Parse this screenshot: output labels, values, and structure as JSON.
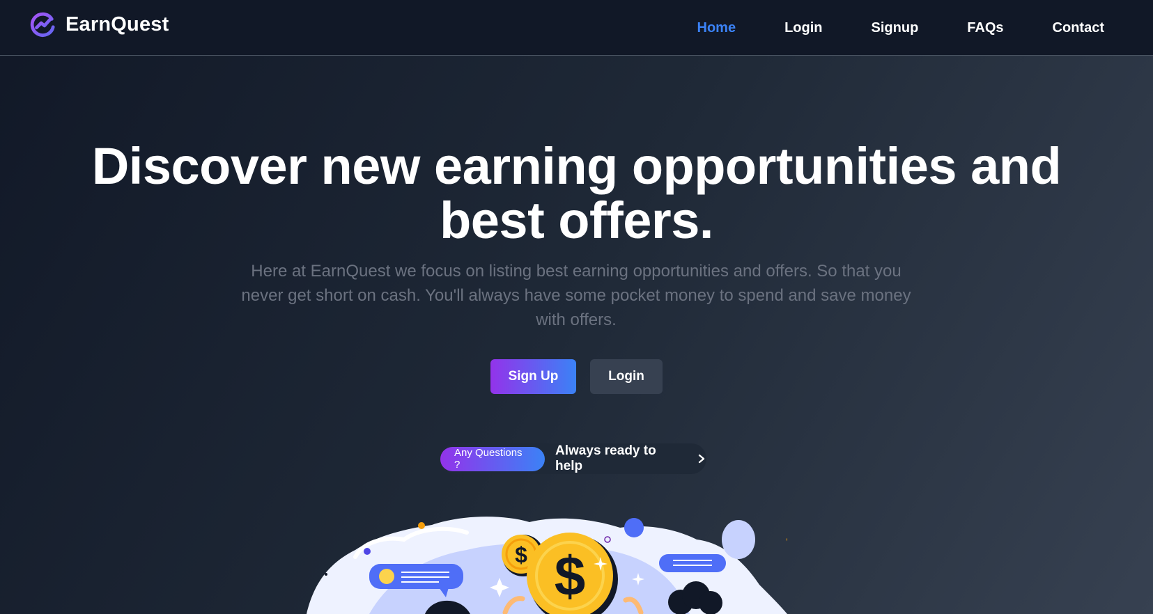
{
  "brand": {
    "name": "EarnQuest",
    "logo_icon": "trend-chart-icon",
    "accent_start": "#9333ea",
    "accent_end": "#3b82f6"
  },
  "nav": {
    "items": [
      {
        "label": "Home",
        "active": true
      },
      {
        "label": "Login",
        "active": false
      },
      {
        "label": "Signup",
        "active": false
      },
      {
        "label": "FAQs",
        "active": false
      },
      {
        "label": "Contact",
        "active": false
      }
    ],
    "active_color": "#3b82f6"
  },
  "hero": {
    "title_line1": "Discover new earning opportunities and",
    "title_line2": "best offers.",
    "description": "Here at EarnQuest we focus on listing best earning opportunities and offers. So that you never get short on cash. You'll always have some pocket money to spend and save money with offers.",
    "signup_label": "Sign Up",
    "login_label": "Login"
  },
  "help": {
    "badge": "Any Questions ?",
    "text": "Always ready to help",
    "icon": "chevron-right-icon"
  },
  "illustration": {
    "icon": "money-coins-illustration"
  }
}
